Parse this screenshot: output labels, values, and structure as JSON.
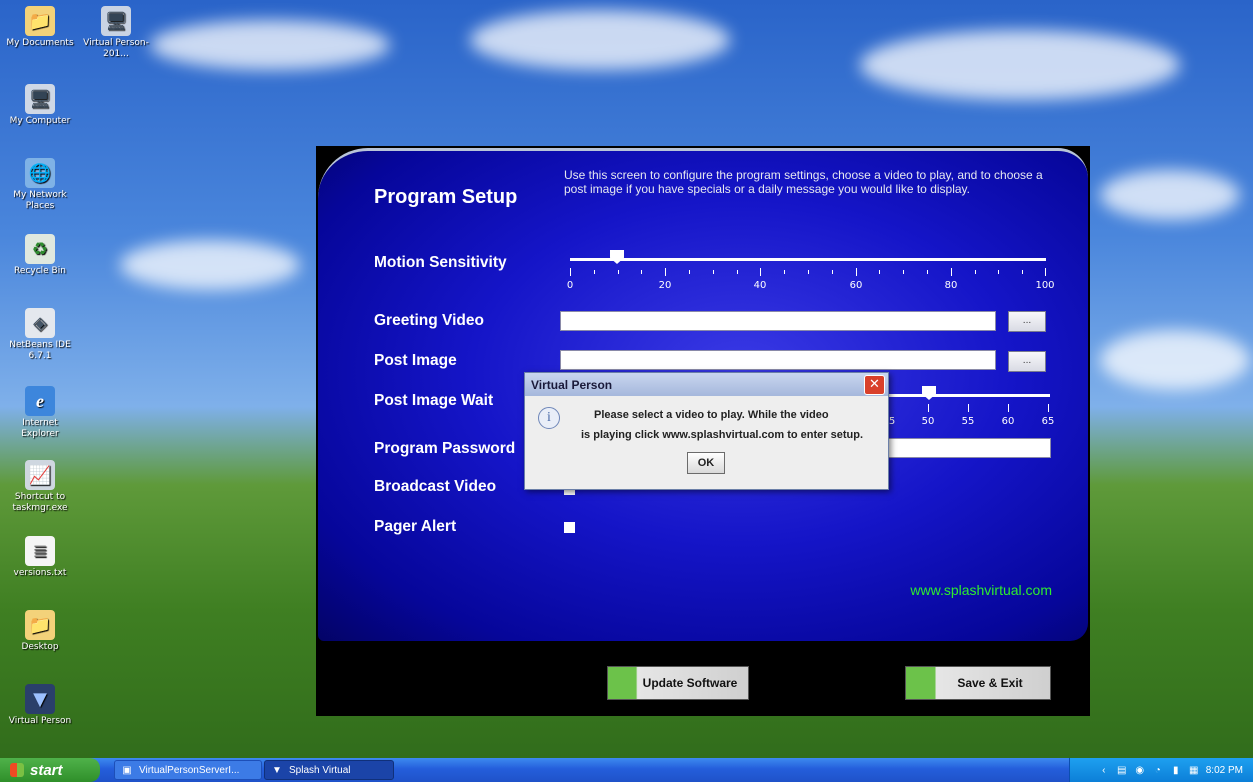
{
  "desktop": {
    "icons": [
      {
        "label": "My Documents",
        "icon": "folder-icon"
      },
      {
        "label": "Virtual Person-201...",
        "icon": "computer-icon"
      },
      {
        "label": "My Computer",
        "icon": "computer-icon"
      },
      {
        "label": "My Network Places",
        "icon": "network-icon"
      },
      {
        "label": "Recycle Bin",
        "icon": "recycle-bin-icon"
      },
      {
        "label": "NetBeans IDE 6.7.1",
        "icon": "cube-icon"
      },
      {
        "label": "Internet Explorer",
        "icon": "ie-icon"
      },
      {
        "label": "Shortcut to taskmgr.exe",
        "icon": "taskmgr-icon"
      },
      {
        "label": "versions.txt",
        "icon": "text-file-icon"
      },
      {
        "label": "Desktop",
        "icon": "folder-icon"
      },
      {
        "label": "Virtual Person",
        "icon": "virtual-person-icon"
      }
    ]
  },
  "app": {
    "title": "Program Setup",
    "description": "Use this screen to configure the program settings, choose a video to play, and to choose a post image if you have specials or a daily message you would like to display.",
    "motion_label": "Motion Sensitivity",
    "motion_value": 10,
    "motion_ticks": [
      "0",
      "20",
      "40",
      "60",
      "80",
      "100"
    ],
    "greeting_label": "Greeting Video",
    "greeting_value": "",
    "post_image_label": "Post Image",
    "post_image_value": "",
    "browse_label": "...",
    "wait_label": "Post Image Wait",
    "wait_ticks_visible": [
      "5",
      "50",
      "55",
      "60",
      "65"
    ],
    "password_label": "Program Password",
    "broadcast_label": "Broadcast Video",
    "pager_label": "Pager Alert",
    "site": "www.splashvirtual.com",
    "update_button": "Update Software",
    "save_button": "Save & Exit",
    "colors": {
      "panel": "#1515c8",
      "link": "#2dee2d",
      "button_accent": "#6cc24a"
    }
  },
  "dialog": {
    "title": "Virtual Person",
    "message_line1": "Please select a video to play. While the video",
    "message_line2": "is playing click www.splashvirtual.com to enter setup.",
    "ok_label": "OK",
    "close_glyph": "✕",
    "info_glyph": "i"
  },
  "taskbar": {
    "start_label": "start",
    "tasks": [
      {
        "label": "VirtualPersonServerI...",
        "icon": "window-icon"
      },
      {
        "label": "Splash Virtual",
        "icon": "virtual-person-icon"
      }
    ],
    "clock": "8:02 PM"
  }
}
